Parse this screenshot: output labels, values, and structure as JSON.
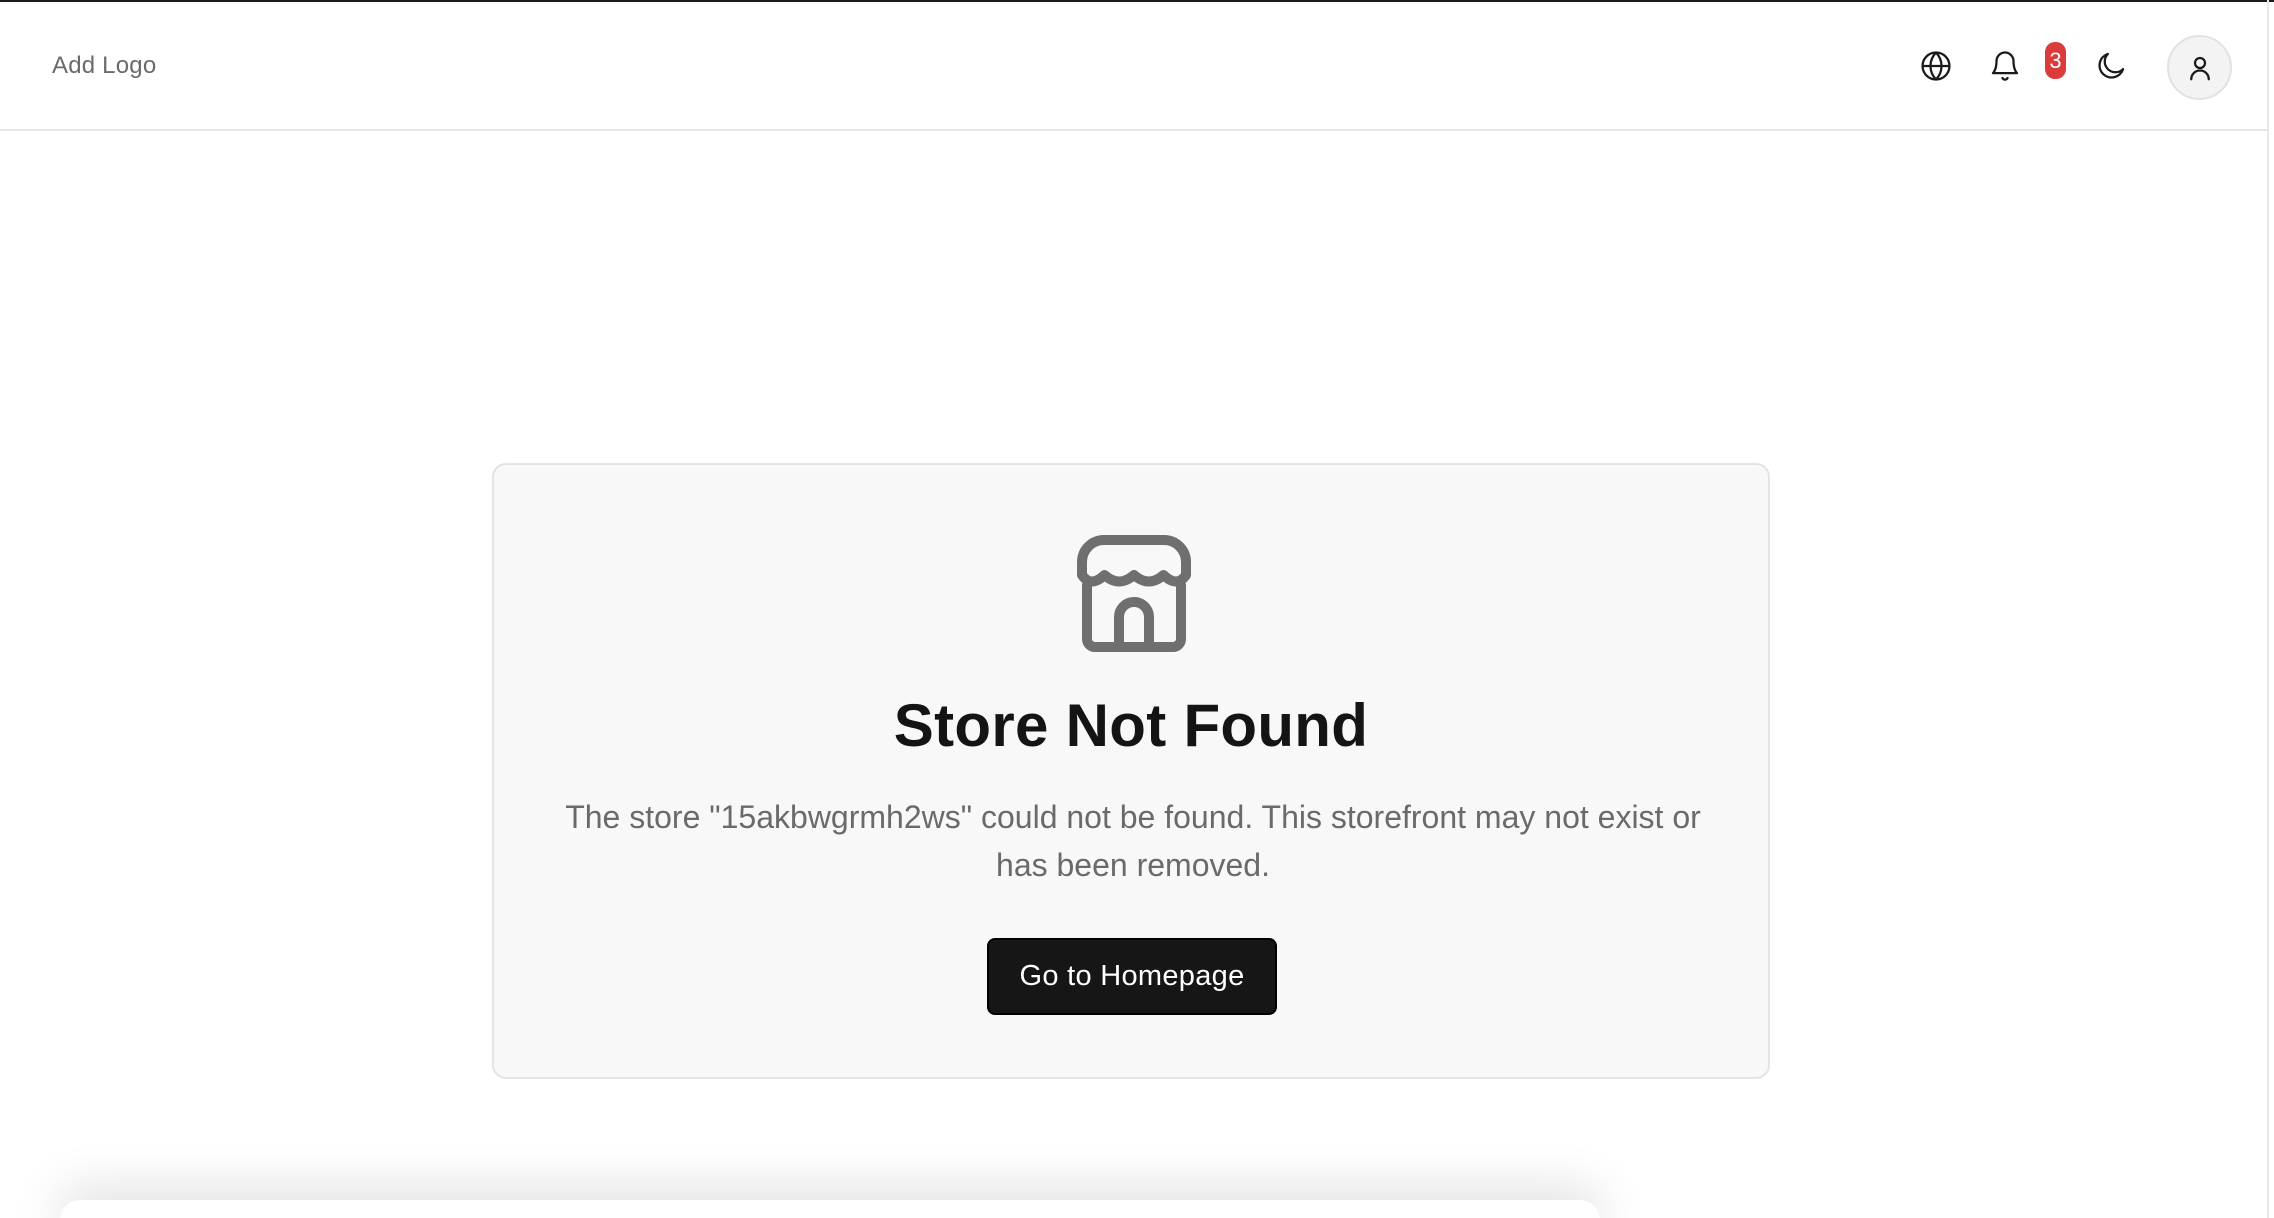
{
  "header": {
    "logo_text": "Add Logo",
    "notification_count": "3",
    "icons": [
      "globe-icon",
      "bell-icon",
      "moon-icon",
      "user-icon"
    ]
  },
  "card": {
    "icon": "store-icon",
    "title": "Store Not Found",
    "message": "The store \"15akbwgrmh2ws\" could not be found. This storefront may not exist or has been removed.",
    "button_label": "Go to Homepage"
  },
  "colors": {
    "badge": "#dc3b3b",
    "button_bg": "#161616",
    "card_bg": "#f8f8f8",
    "icon_gray": "#6f6f6f"
  }
}
